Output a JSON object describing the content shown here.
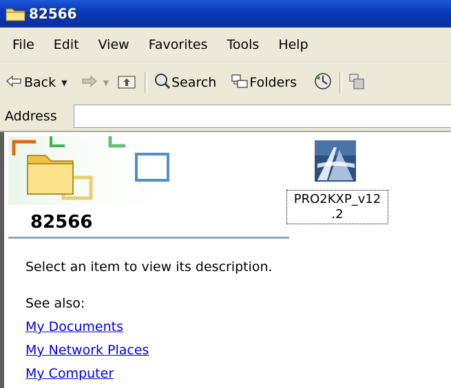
{
  "window": {
    "title": "82566"
  },
  "menu": [
    "File",
    "Edit",
    "View",
    "Favorites",
    "Tools",
    "Help"
  ],
  "toolbar": {
    "back_label": "Back",
    "search_label": "Search",
    "folders_label": "Folders",
    "icons": [
      "back-arrow-icon",
      "forward-arrow-icon",
      "up-folder-icon",
      "search-icon",
      "folders-icon",
      "history-icon",
      "move-to-icon"
    ]
  },
  "address": {
    "label": "Address",
    "value": ""
  },
  "task_pane": {
    "folder_name": "82566",
    "description": "Select an item to view its description.",
    "see_also_label": "See also:",
    "links": [
      "My Documents",
      "My Network Places",
      "My Computer"
    ]
  },
  "files": [
    {
      "name_line1": "PRO2KXP_v12",
      "name_line2": ".2",
      "icon": "installer-icon"
    }
  ]
}
